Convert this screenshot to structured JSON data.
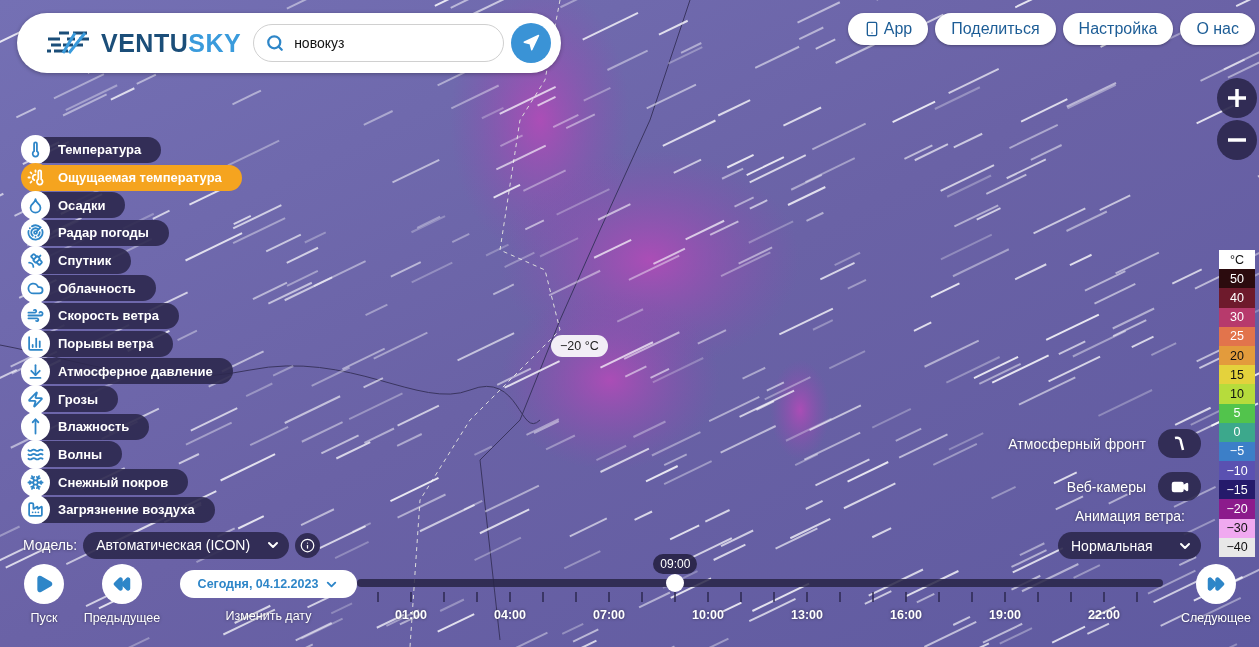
{
  "logo": [
    "VENTU",
    "SKY"
  ],
  "search": {
    "value": "новокуз"
  },
  "nav": [
    {
      "label": "App",
      "kind": "app"
    },
    {
      "label": "Поделиться",
      "kind": "plain"
    },
    {
      "label": "Настройка",
      "kind": "plain"
    },
    {
      "label": "О нас",
      "kind": "plain"
    }
  ],
  "layers": [
    {
      "label": "Температура",
      "selected": false
    },
    {
      "label": "Ощущаемая температура",
      "selected": true
    },
    {
      "label": "Осадки",
      "selected": false
    },
    {
      "label": "Радар погоды",
      "selected": false
    },
    {
      "label": "Спутник",
      "selected": false
    },
    {
      "label": "Облачность",
      "selected": false
    },
    {
      "label": "Скорость ветра",
      "selected": false
    },
    {
      "label": "Порывы ветра",
      "selected": false
    },
    {
      "label": "Атмосферное давление",
      "selected": false
    },
    {
      "label": "Грозы",
      "selected": false
    },
    {
      "label": "Влажность",
      "selected": false
    },
    {
      "label": "Волны",
      "selected": false
    },
    {
      "label": "Снежный покров",
      "selected": false
    },
    {
      "label": "Загрязнение воздуха",
      "selected": false
    }
  ],
  "model": {
    "label": "Модель:",
    "value": "Автоматическая (ICON)"
  },
  "map_marker": "−20 °C",
  "overlays": [
    {
      "label": "Атмосферный фронт",
      "kind": "front",
      "on": false
    },
    {
      "label": "Веб-камеры",
      "kind": "webcam",
      "on": false
    }
  ],
  "wind_animation": {
    "label": "Анимация ветра:",
    "value": "Нормальная"
  },
  "legend": [
    {
      "label": "°C",
      "color": "#ffffff"
    },
    {
      "label": "50",
      "color": "#2b0b0e"
    },
    {
      "label": "40",
      "color": "#6e1a2c"
    },
    {
      "label": "30",
      "color": "#b73a6c"
    },
    {
      "label": "25",
      "color": "#e2744c"
    },
    {
      "label": "20",
      "color": "#e39b3c"
    },
    {
      "label": "15",
      "color": "#e4d23c"
    },
    {
      "label": "10",
      "color": "#b6dc3c"
    },
    {
      "label": "5",
      "color": "#52c44c"
    },
    {
      "label": "0",
      "color": "#3ca88c"
    },
    {
      "label": "−5",
      "color": "#3c7fc8"
    },
    {
      "label": "−10",
      "color": "#5a51b1"
    },
    {
      "label": "−15",
      "color": "#251a6b"
    },
    {
      "label": "−20",
      "color": "#8c1b8c"
    },
    {
      "label": "−30",
      "color": "#f0a9f0"
    },
    {
      "label": "−40",
      "color": "#e8e8e8"
    }
  ],
  "timeline": {
    "play": "Пуск",
    "previous": "Предыдущее",
    "next": "Следующее",
    "date": "Сегодня, 04.12.2023",
    "date_caption": "Изменить дату",
    "current_time": "09:00",
    "level": 0.395,
    "hours": [
      "01:00",
      "04:00",
      "07:00",
      "10:00",
      "13:00",
      "16:00",
      "19:00",
      "22:00"
    ]
  }
}
